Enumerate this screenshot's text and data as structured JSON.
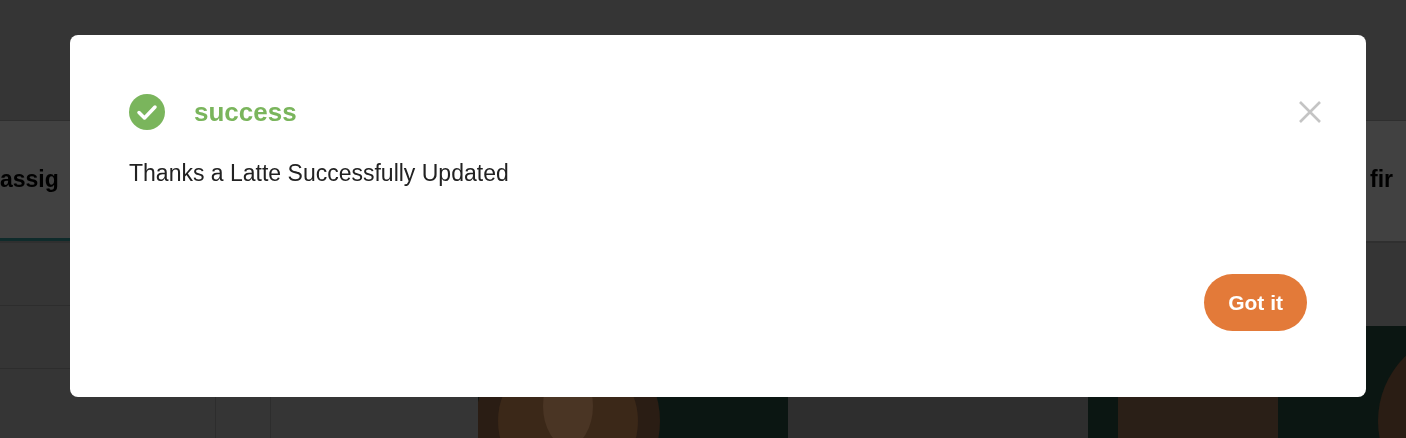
{
  "page": {
    "tabs": [
      {
        "label": "assig",
        "selected": true
      },
      {
        "label": "fir",
        "selected": false
      }
    ]
  },
  "dialog": {
    "status": {
      "kind": "success",
      "label": "success"
    },
    "message": "Thanks a Latte Successfully Updated",
    "button": "Got it"
  }
}
